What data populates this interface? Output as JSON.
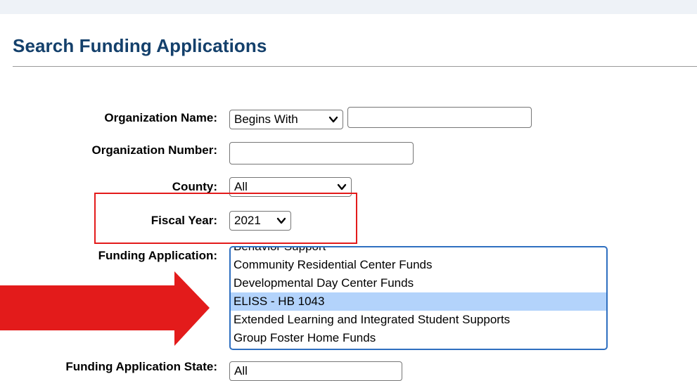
{
  "page": {
    "title": "Search Funding Applications"
  },
  "form": {
    "organization_name": {
      "label": "Organization Name:",
      "match_mode": "Begins With",
      "value": ""
    },
    "organization_number": {
      "label": "Organization Number:",
      "value": ""
    },
    "county": {
      "label": "County:",
      "value": "All"
    },
    "fiscal_year": {
      "label": "Fiscal Year:",
      "value": "2021"
    },
    "funding_application": {
      "label": "Funding Application:",
      "options": [
        "Behavior Support",
        "Community Residential Center Funds",
        "Developmental Day Center Funds",
        "ELISS - HB 1043",
        "Extended Learning and Integrated Student Supports",
        "Group Foster Home Funds"
      ],
      "selected": "ELISS - HB 1043"
    },
    "funding_application_state": {
      "label": "Funding Application State:",
      "value": "All"
    }
  },
  "annotations": {
    "highlight_color": "#e31b1b",
    "arrow_color": "#e31b1b"
  },
  "icons": [
    "chevron-down-icon"
  ]
}
